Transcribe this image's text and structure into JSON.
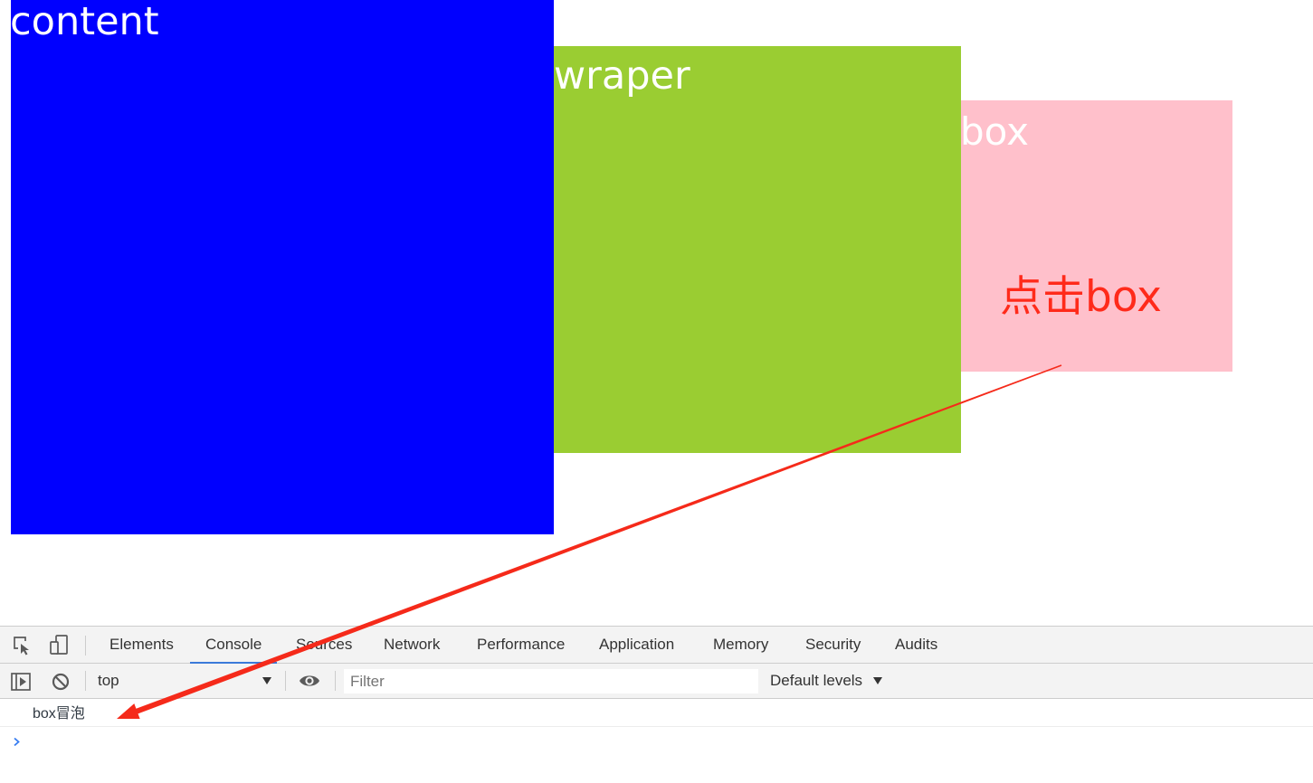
{
  "page": {
    "content_box": {
      "label": "content",
      "color": "#0000ff"
    },
    "wraper_box": {
      "label": "wraper",
      "color": "#9acd32"
    },
    "box_box": {
      "label": "box",
      "color": "#ffc0cb"
    },
    "annotation": {
      "text": "点击box",
      "color": "#ff2a1a",
      "arrow_color": "#f52a1a"
    }
  },
  "devtools": {
    "accent_color": "#3a7ad9",
    "prompt_color": "#367cf1",
    "icons": {
      "inspect": "inspect-element-icon",
      "device": "device-toolbar-icon",
      "sidebar": "show-console-sidebar-icon",
      "clear": "clear-console-icon",
      "context_dropdown": "caret-down-icon",
      "eye": "live-expression-eye-icon",
      "levels_dropdown": "caret-down-icon",
      "prompt": "chevron-right-icon"
    },
    "tabs": [
      {
        "label": "Elements",
        "selected": false
      },
      {
        "label": "Console",
        "selected": true
      },
      {
        "label": "Sources",
        "selected": false
      },
      {
        "label": "Network",
        "selected": false
      },
      {
        "label": "Performance",
        "selected": false
      },
      {
        "label": "Application",
        "selected": false
      },
      {
        "label": "Memory",
        "selected": false
      },
      {
        "label": "Security",
        "selected": false
      },
      {
        "label": "Audits",
        "selected": false
      }
    ],
    "console_toolbar": {
      "context": "top",
      "filter_placeholder": "Filter",
      "levels": "Default levels"
    },
    "messages": [
      {
        "text": "box冒泡"
      }
    ]
  }
}
